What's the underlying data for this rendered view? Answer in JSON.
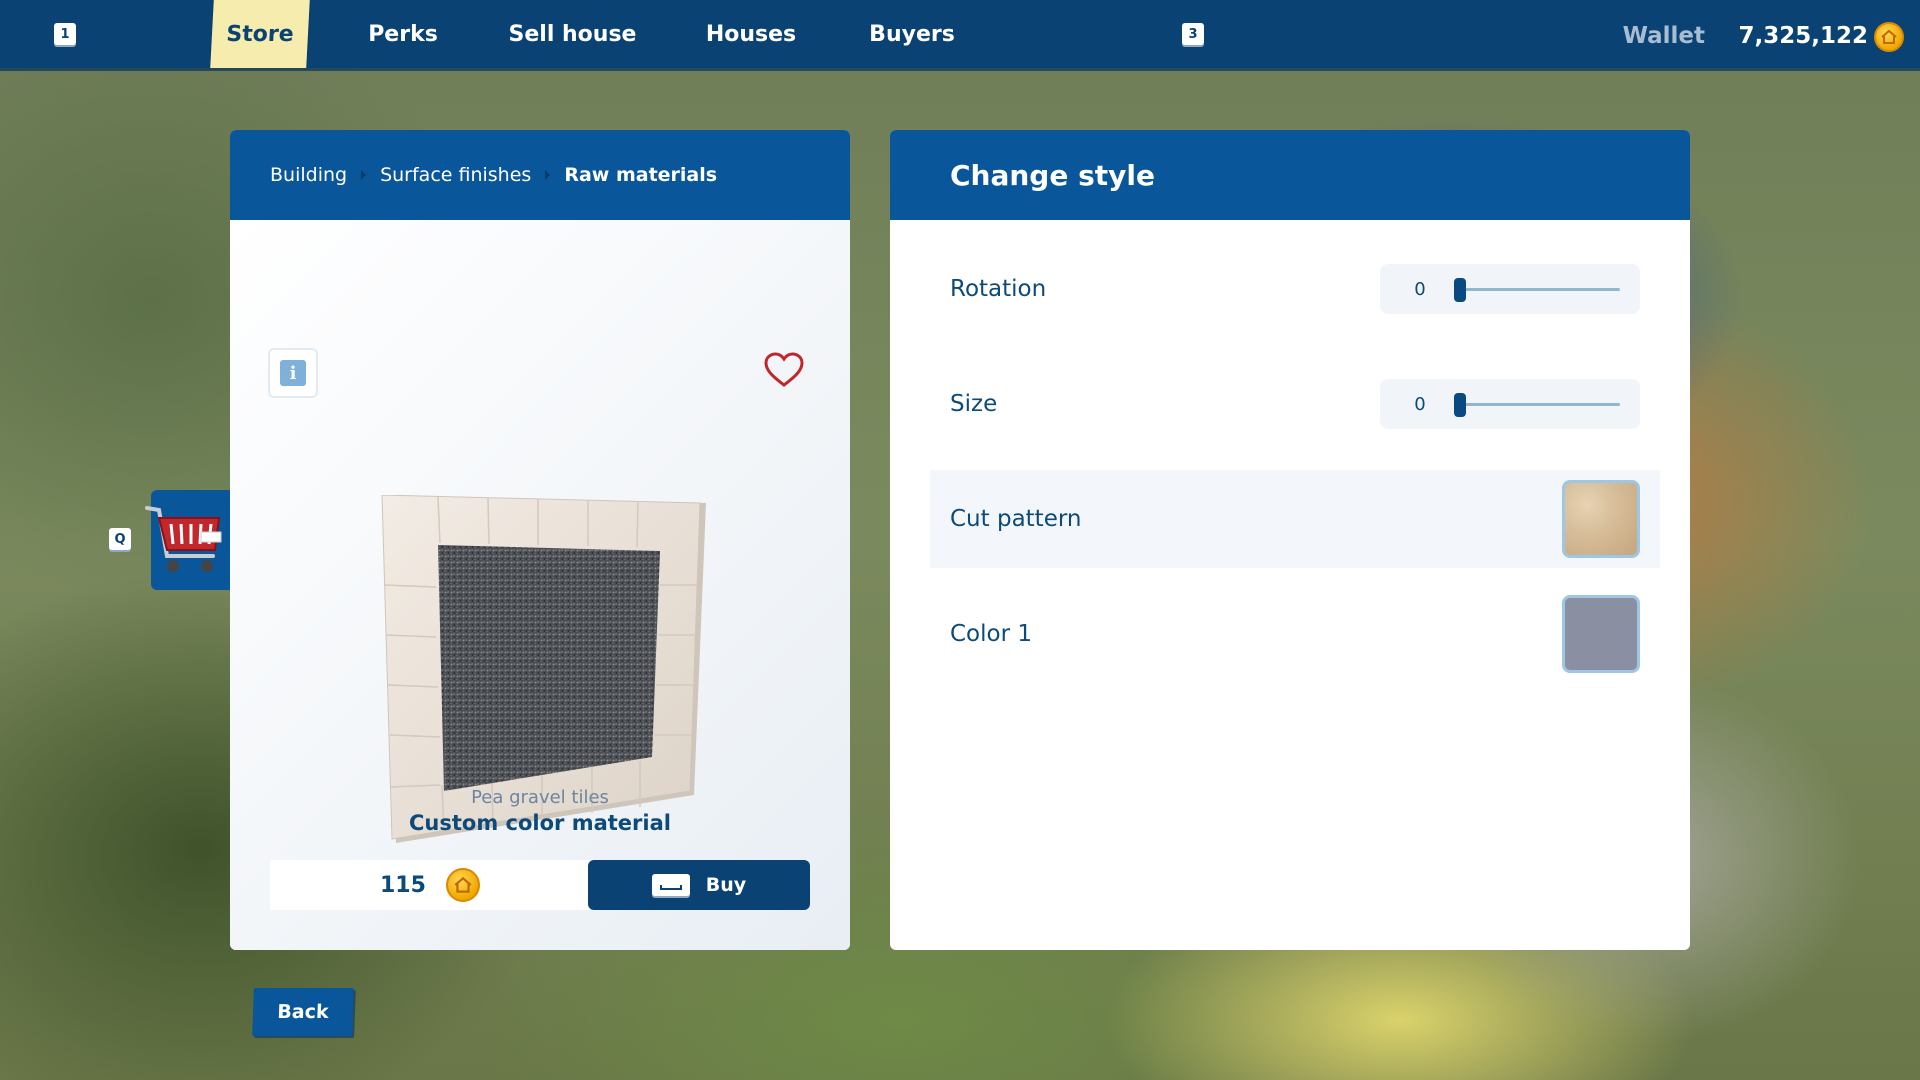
{
  "topbar": {
    "left_key": "1",
    "right_key": "3",
    "tabs": [
      {
        "label": "Store",
        "active": true
      },
      {
        "label": "Perks",
        "active": false
      },
      {
        "label": "Sell house",
        "active": false
      },
      {
        "label": "Houses",
        "active": false
      },
      {
        "label": "Buyers",
        "active": false
      }
    ],
    "wallet_label": "Wallet",
    "wallet_value": "7,325,122",
    "coin_icon": "house-coin-icon"
  },
  "side_tab": {
    "key": "Q",
    "icon": "shopping-cart-icon"
  },
  "product": {
    "breadcrumb": [
      "Building",
      "Surface finishes",
      "Raw materials"
    ],
    "info_icon": "info-icon",
    "favorite_icon": "heart-icon",
    "subtitle": "Pea gravel tiles",
    "name": "Custom color material",
    "price": "115",
    "buy_label": "Buy",
    "buy_key_icon": "spacebar-key-icon"
  },
  "style_panel": {
    "title": "Change style",
    "rows": [
      {
        "label": "Rotation",
        "type": "slider",
        "value": "0"
      },
      {
        "label": "Size",
        "type": "slider",
        "value": "0"
      },
      {
        "label": "Cut pattern",
        "type": "swatch",
        "swatch_color": "#d6bc97"
      },
      {
        "label": "Color 1",
        "type": "swatch",
        "swatch_color": "#8a8fa1"
      }
    ]
  },
  "back_label": "Back",
  "colors": {
    "topbar": "#0a4273",
    "panel_header": "#0a569a",
    "active_tab": "#f6ecad",
    "text_primary": "#0d4a7a"
  }
}
